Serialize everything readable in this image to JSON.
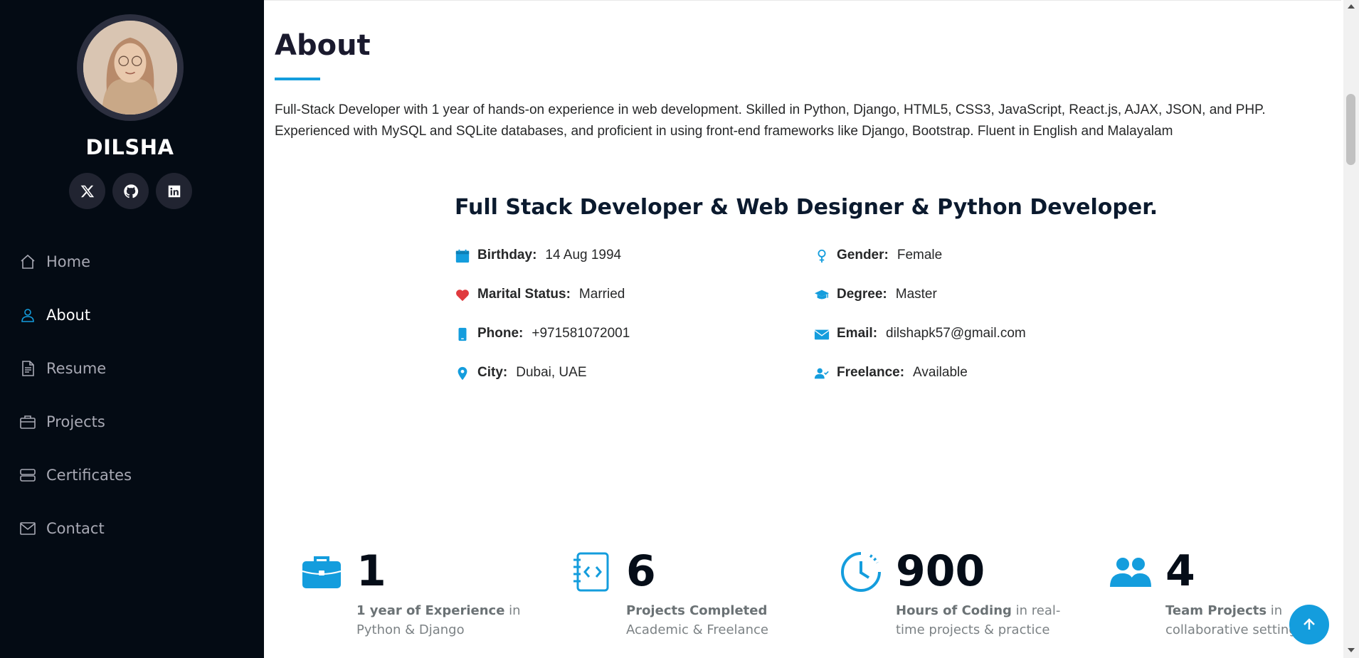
{
  "profile": {
    "name": "DILSHA",
    "avatar_icon": "profile-photo"
  },
  "social": [
    {
      "name": "x-twitter-icon"
    },
    {
      "name": "github-icon"
    },
    {
      "name": "linkedin-icon"
    }
  ],
  "nav": {
    "items": [
      {
        "label": "Home",
        "icon": "house-icon"
      },
      {
        "label": "About",
        "icon": "person-icon",
        "active": true
      },
      {
        "label": "Resume",
        "icon": "file-text-icon"
      },
      {
        "label": "Projects",
        "icon": "briefcase-icon"
      },
      {
        "label": "Certificates",
        "icon": "server-icon"
      },
      {
        "label": "Contact",
        "icon": "envelope-icon"
      }
    ]
  },
  "about": {
    "title": "About",
    "intro_line1": "Full-Stack Developer with 1 year of hands-on experience in web development. Skilled in Python, Django, HTML5, CSS3, JavaScript, React.js, AJAX, JSON, and PHP.",
    "intro_line2": "Experienced with MySQL and SQLite databases, and proficient in using front-end frameworks like Django, Bootstrap. Fluent in English and Malayalam",
    "role": "Full Stack Developer & Web Designer & Python Developer.",
    "left": [
      {
        "label": "Birthday:",
        "value": "14 Aug 1994",
        "icon": "calendar-icon"
      },
      {
        "label": "Marital Status:",
        "value": "Married",
        "icon": "heart-icon"
      },
      {
        "label": "Phone:",
        "value": "+971581072001",
        "icon": "phone-icon"
      },
      {
        "label": "City:",
        "value": "Dubai, UAE",
        "icon": "location-pin-icon"
      }
    ],
    "right": [
      {
        "label": "Gender:",
        "value": "Female",
        "icon": "female-icon"
      },
      {
        "label": "Degree:",
        "value": "Master",
        "icon": "graduation-cap-icon"
      },
      {
        "label": "Email:",
        "value": "dilshapk57@gmail.com",
        "icon": "envelope-icon"
      },
      {
        "label": "Freelance:",
        "value": "Available",
        "icon": "person-check-icon"
      }
    ]
  },
  "stats": [
    {
      "number": "1",
      "bold": "1 year of Experience",
      "rest": " in Python & Django",
      "icon": "briefcase-icon"
    },
    {
      "number": "6",
      "bold": "Projects Completed",
      "rest": " Academic & Freelance",
      "icon": "code-journal-icon"
    },
    {
      "number": "900",
      "bold": "Hours of Coding",
      "rest": " in real-time projects & practice",
      "icon": "clock-icon"
    },
    {
      "number": "4",
      "bold": "Team Projects",
      "rest": " in collaborative settings",
      "icon": "people-icon"
    }
  ],
  "colors": {
    "sidebar_bg": "#040b14",
    "accent": "#149ddd",
    "heart": "#e03a3e"
  }
}
